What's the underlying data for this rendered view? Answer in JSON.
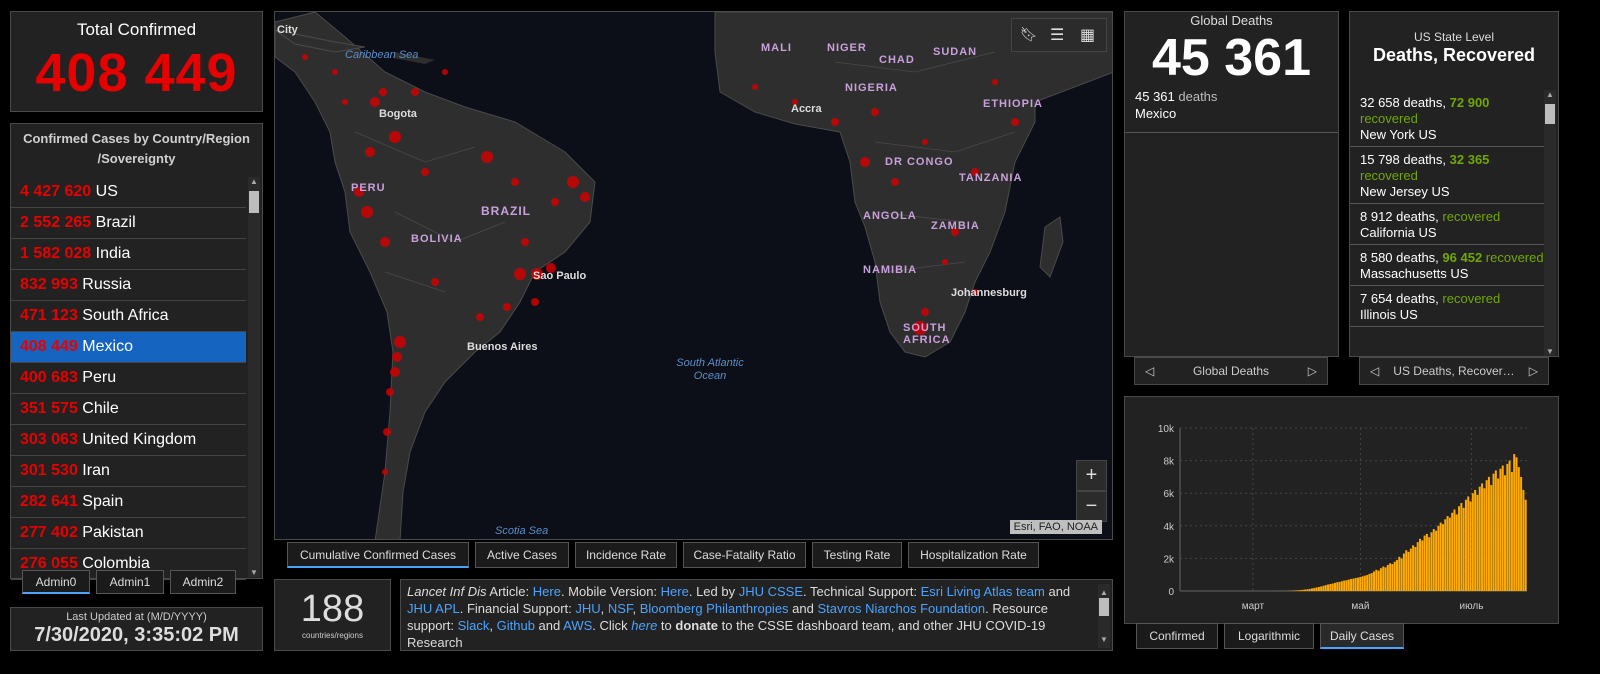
{
  "total": {
    "title": "Total Confirmed",
    "value": "408 449"
  },
  "countries": {
    "header": "Confirmed Cases by Country/Region /Sovereignty",
    "items": [
      {
        "num": "4 427 620",
        "name": "US"
      },
      {
        "num": "2 552 265",
        "name": "Brazil"
      },
      {
        "num": "1 582 028",
        "name": "India"
      },
      {
        "num": "832 993",
        "name": "Russia"
      },
      {
        "num": "471 123",
        "name": "South Africa"
      },
      {
        "num": "408 449",
        "name": "Mexico",
        "selected": true
      },
      {
        "num": "400 683",
        "name": "Peru"
      },
      {
        "num": "351 575",
        "name": "Chile"
      },
      {
        "num": "303 063",
        "name": "United Kingdom"
      },
      {
        "num": "301 530",
        "name": "Iran"
      },
      {
        "num": "282 641",
        "name": "Spain"
      },
      {
        "num": "277 402",
        "name": "Pakistan"
      },
      {
        "num": "276 055",
        "name": "Colombia"
      }
    ]
  },
  "admin_tabs": [
    "Admin0",
    "Admin1",
    "Admin2"
  ],
  "updated": {
    "label": "Last Updated at (M/D/YYYY)",
    "value": "7/30/2020, 3:35:02 PM"
  },
  "map": {
    "country_labels": [
      "MALI",
      "NIGER",
      "SUDAN",
      "CHAD",
      "NIGERIA",
      "ETHIOPIA",
      "DR CONGO",
      "TANZANIA",
      "ANGOLA",
      "ZAMBIA",
      "NAMIBIA",
      "SOUTH AFRICA",
      "BRAZIL",
      "PERU",
      "BOLIVIA"
    ],
    "city_labels": [
      "City",
      "Bogota",
      "Accra",
      "Sao Paulo",
      "Johannesburg",
      "Buenos Aires"
    ],
    "ocean_labels": [
      "Caribbean Sea",
      "South Atlantic Ocean",
      "Scotia Sea"
    ],
    "attribution": "Esri, FAO, NOAA",
    "zoom_in": "+",
    "zoom_out": "−",
    "tools": [
      "bookmark-icon",
      "list-icon",
      "qr-icon"
    ]
  },
  "map_tabs": [
    "Cumulative Confirmed Cases",
    "Active Cases",
    "Incidence Rate",
    "Case-Fatality Ratio",
    "Testing Rate",
    "Hospitalization Rate"
  ],
  "count": {
    "value": "188",
    "label": "countries/regions"
  },
  "info": {
    "article_title": "Lancet Inf Dis",
    "article_word": " Article: ",
    "here1": "Here",
    "mobile": ". Mobile Version: ",
    "here2": "Here",
    "led": ". Led by ",
    "jhu_csse": "JHU CSSE",
    "tech": ". Technical Support: ",
    "esri": "Esri Living Atlas team",
    "and1": " and ",
    "jhu_apl": "JHU APL",
    "fin": ". Financial Support: ",
    "jhu": "JHU",
    "comma1": ", ",
    "nsf": "NSF",
    "comma2": ", ",
    "bloomberg": "Bloomberg Philanthropies",
    "and2": " and ",
    "stavros": "Stavros Niarchos Foundation",
    "res": ". Resource support: ",
    "slack": "Slack",
    "comma3": ", ",
    "github": "Github",
    "and3": " and ",
    "aws": "AWS",
    "click": ". Click ",
    "here3": "here",
    "to": " to ",
    "donate": "donate",
    "rest": " to the CSSE dashboard team, and other JHU COVID-19 Research"
  },
  "deaths": {
    "title": "Global Deaths",
    "value": "45 361",
    "row_num": "45 361",
    "row_unit": " deaths",
    "row_name": "Mexico",
    "pager": "Global Deaths"
  },
  "us": {
    "title1": "US State Level",
    "title2": "Deaths, Recovered",
    "items": [
      {
        "deaths": "32 658 deaths, ",
        "recovered_num": "72 900",
        "recovered": " recovered",
        "name": "New York US"
      },
      {
        "deaths": "15 798 deaths, ",
        "recovered_num": "32 365",
        "recovered": " recovered",
        "name": "New Jersey US"
      },
      {
        "deaths": "8 912 deaths, ",
        "recovered_num": "",
        "recovered": " recovered",
        "name": "California US"
      },
      {
        "deaths": "8 580 deaths, ",
        "recovered_num": "96 452",
        "recovered": " recovered",
        "name": "Massachusetts US"
      },
      {
        "deaths": "7 654 deaths, ",
        "recovered_num": "",
        "recovered": " recovered",
        "name": "Illinois US"
      }
    ],
    "pager": "US Deaths, Recover…"
  },
  "chart_tabs": [
    "Confirmed",
    "Logarithmic",
    "Daily Cases"
  ],
  "colors": {
    "accent_red": "#e60000",
    "recovered_green": "#70a800",
    "link_blue": "#4aa3ff",
    "bar_orange": "#ffaa00",
    "selected_row": "#1565c0"
  },
  "chart_data": {
    "type": "bar",
    "title": "",
    "xlabel": "",
    "ylabel": "",
    "ylim": [
      0,
      10000
    ],
    "yticks": [
      "0",
      "2k",
      "4k",
      "6k",
      "8k",
      "10k"
    ],
    "xticks": [
      "март",
      "май",
      "июль"
    ],
    "values": [
      0,
      0,
      0,
      0,
      0,
      0,
      0,
      0,
      0,
      0,
      0,
      0,
      0,
      0,
      0,
      0,
      0,
      0,
      0,
      0,
      0,
      0,
      0,
      0,
      0,
      0,
      0,
      0,
      0,
      0,
      0,
      0,
      0,
      0,
      0,
      0,
      0,
      0,
      0,
      0,
      1,
      1,
      2,
      3,
      5,
      7,
      10,
      14,
      20,
      28,
      36,
      45,
      60,
      75,
      90,
      110,
      130,
      160,
      190,
      220,
      250,
      280,
      320,
      360,
      400,
      430,
      460,
      500,
      540,
      560,
      600,
      640,
      660,
      700,
      740,
      760,
      800,
      820,
      860,
      900,
      940,
      980,
      1050,
      1100,
      1200,
      1300,
      1250,
      1400,
      1500,
      1450,
      1600,
      1700,
      1650,
      1800,
      1900,
      2100,
      2000,
      2300,
      2500,
      2400,
      2600,
      2800,
      2700,
      3000,
      3200,
      3100,
      3400,
      3500,
      3300,
      3600,
      3800,
      3700,
      4000,
      4200,
      4100,
      4400,
      4600,
      4500,
      4800,
      5000,
      4700,
      5200,
      5400,
      5100,
      5600,
      5800,
      5500,
      6000,
      6200,
      5900,
      6400,
      6600,
      6300,
      6800,
      7000,
      6500,
      7200,
      7400,
      6900,
      7500,
      7700,
      7100,
      7800,
      8000,
      7300,
      8400,
      8200,
      7600,
      7000,
      6200,
      5600
    ]
  }
}
